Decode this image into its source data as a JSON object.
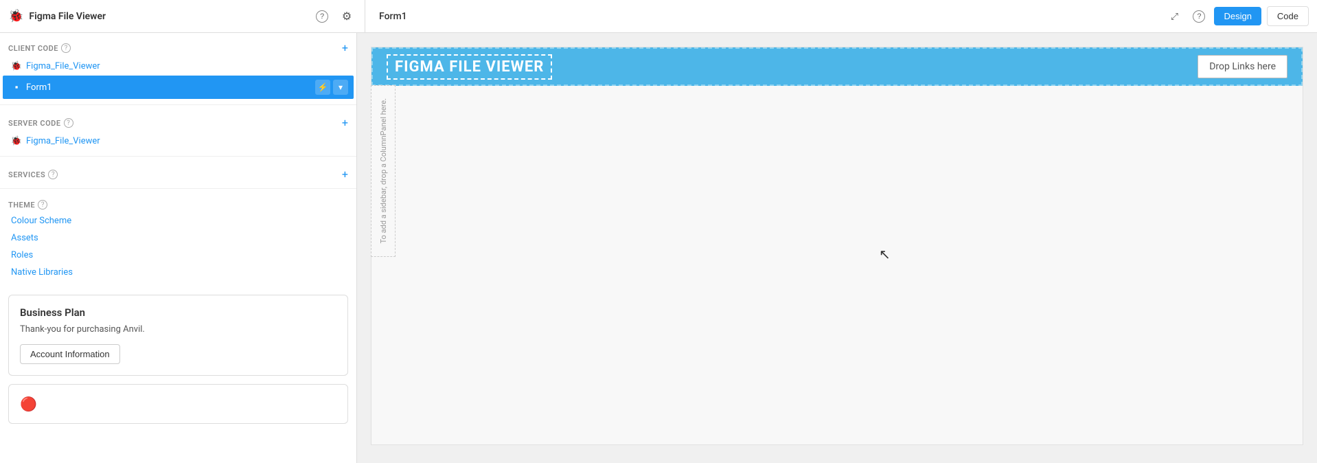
{
  "topbar": {
    "app_logo": "🐞",
    "app_title": "Figma File Viewer",
    "help_icon": "?",
    "gear_icon": "⚙",
    "form_title": "Form1",
    "expand_icon": "⤢",
    "help2_icon": "?",
    "design_btn": "Design",
    "code_btn": "Code"
  },
  "sidebar": {
    "client_code_label": "CLIENT CODE",
    "client_help": "?",
    "client_add": "+",
    "client_items": [
      {
        "name": "Figma_File_Viewer",
        "icon": "🐞"
      }
    ],
    "form1_label": "Form1",
    "form1_lightning": "⚡",
    "form1_chevron": "▾",
    "server_code_label": "SERVER CODE",
    "server_help": "?",
    "server_add": "+",
    "server_items": [
      {
        "name": "Figma_File_Viewer",
        "icon": "🐞"
      }
    ],
    "services_label": "SERVICES",
    "services_help": "?",
    "services_add": "+",
    "theme_label": "THEME",
    "theme_help": "?",
    "theme_items": [
      {
        "name": "Colour Scheme"
      },
      {
        "name": "Assets"
      },
      {
        "name": "Roles"
      },
      {
        "name": "Native Libraries"
      }
    ]
  },
  "business_plan": {
    "title": "Business Plan",
    "description": "Thank-you for purchasing Anvil.",
    "button_label": "Account Information"
  },
  "get_started": {
    "icon": "🔴"
  },
  "canvas": {
    "header_title": "FIGMA FILE VIEWER",
    "drop_links_label": "Drop Links here",
    "column_panel_text": "To add a sidebar, drop a ColumnPanel here."
  }
}
